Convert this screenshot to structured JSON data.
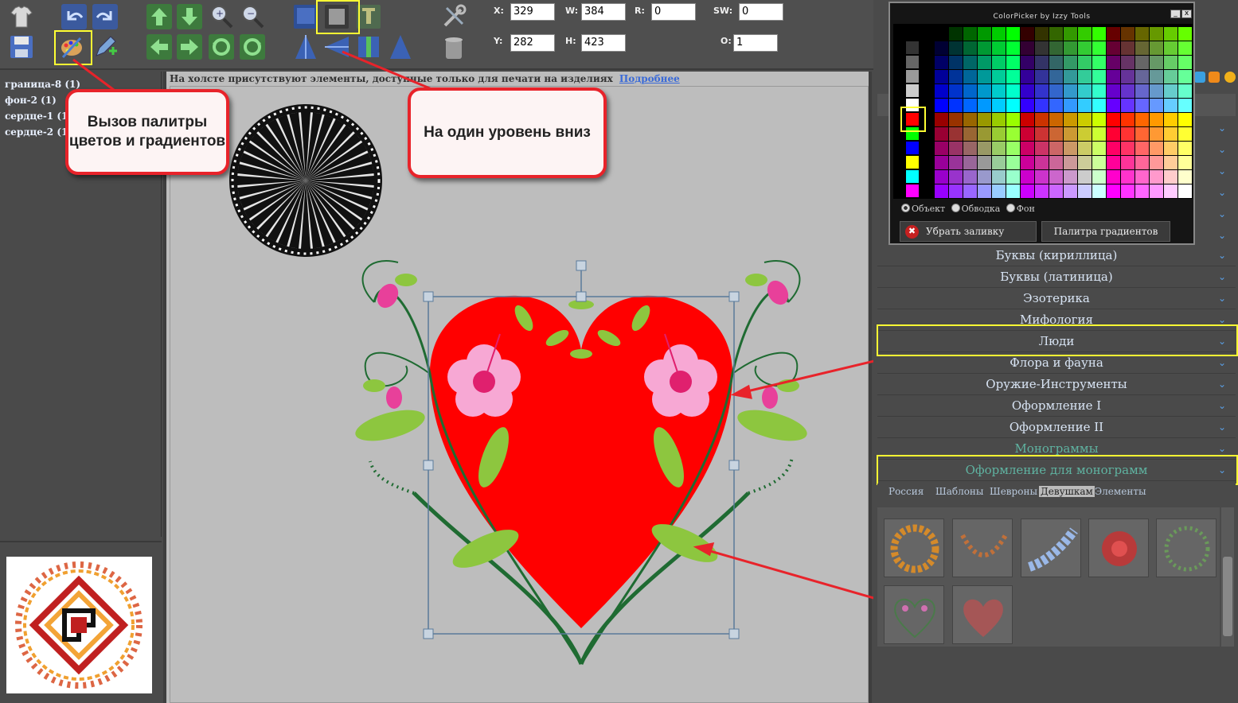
{
  "toolbar": {
    "x_label": "X:",
    "x_value": "329",
    "y_label": "Y:",
    "y_value": "282",
    "w_label": "W:",
    "w_value": "384",
    "h_label": "H:",
    "h_value": "423",
    "r_label": "R:",
    "r_value": "0",
    "sw_label": "SW:",
    "sw_value": "0",
    "o_label": "O:",
    "o_value": "1"
  },
  "layers": [
    {
      "label": "граница-8 (1)"
    },
    {
      "label": "фон-2 (1)"
    },
    {
      "label": "сердце-1 (1)"
    },
    {
      "label": "сердце-2 (1)"
    }
  ],
  "canvas": {
    "note": "На холсте присутствуют элементы, доступные только для печати на изделиях",
    "note_link": "Подробнее"
  },
  "callouts": {
    "palette": "Вызов палитры цветов и градиентов",
    "down_one_level": "На один уровень вниз"
  },
  "color_picker": {
    "title": "ColorPicker by Izzy Tools",
    "radio_object": "Объект",
    "radio_stroke": "Обводка",
    "radio_bg": "Фон",
    "remove_fill": "Убрать заливку",
    "gradient_palette": "Палитра градиентов",
    "close_label": "x",
    "minimize_label": "_"
  },
  "categories": [
    {
      "label": "Буквы (кириллица)"
    },
    {
      "label": "Буквы (латиница)"
    },
    {
      "label": "Эзотерика"
    },
    {
      "label": "Мифология"
    },
    {
      "label": "Люди"
    },
    {
      "label": "Флора и фауна"
    },
    {
      "label": "Оружие-Инструменты"
    },
    {
      "label": "Оформление I"
    },
    {
      "label": "Оформление II"
    },
    {
      "label": "Монограммы"
    },
    {
      "label": "Оформление для монограмм"
    }
  ],
  "tabs": [
    {
      "label": "Россия"
    },
    {
      "label": "Шаблоны"
    },
    {
      "label": "Шевроны"
    },
    {
      "label": "Девушкам"
    },
    {
      "label": "Элементы"
    }
  ],
  "colors": {
    "highlight": "#ffff33",
    "callout_border": "#e8232a",
    "heart_red": "#ff0000",
    "arrow": "#e8232a"
  }
}
